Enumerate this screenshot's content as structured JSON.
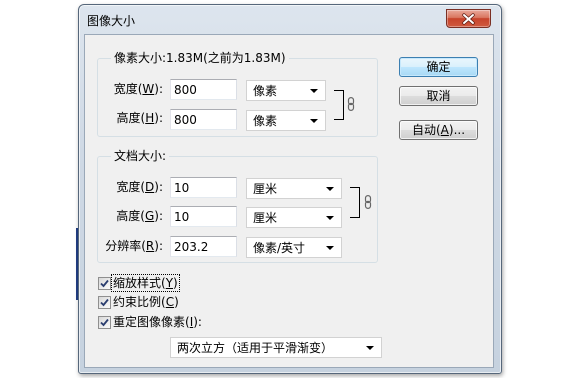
{
  "window": {
    "title": "图像大小"
  },
  "pixel_dimensions": {
    "legend": "像素大小:1.83M(之前为1.83M)",
    "width": {
      "label": "宽度(W):",
      "value": "800",
      "unit": "像素"
    },
    "height": {
      "label": "高度(H):",
      "value": "800",
      "unit": "像素"
    }
  },
  "document_size": {
    "legend": "文档大小:",
    "width": {
      "label": "宽度(D):",
      "value": "10",
      "unit": "厘米"
    },
    "height": {
      "label": "高度(G):",
      "value": "10",
      "unit": "厘米"
    },
    "resolution": {
      "label": "分辨率(R):",
      "value": "203.2",
      "unit": "像素/英寸"
    }
  },
  "options": {
    "scale_styles": {
      "label": "缩放样式(Y)",
      "checked": true,
      "focused": true
    },
    "constrain_proportions": {
      "label": "约束比例(C)",
      "checked": true
    },
    "resample_image": {
      "label": "重定图像像素(I):",
      "checked": true
    },
    "resample_method": "两次立方（适用于平滑渐变）"
  },
  "buttons": {
    "ok": "确定",
    "cancel": "取消",
    "auto": "自动(A)..."
  },
  "icons": {
    "close": "close-icon",
    "pixel_link": "chain-link-icon",
    "document_link": "chain-link-icon",
    "dropdown_arrow": "chevron-down-icon",
    "checkbox_mark": "checkmark-icon"
  },
  "colors": {
    "dialog_background": "#f0f0f0",
    "default_button_border": "#3c7fb1",
    "close_button": "#c7432b"
  }
}
